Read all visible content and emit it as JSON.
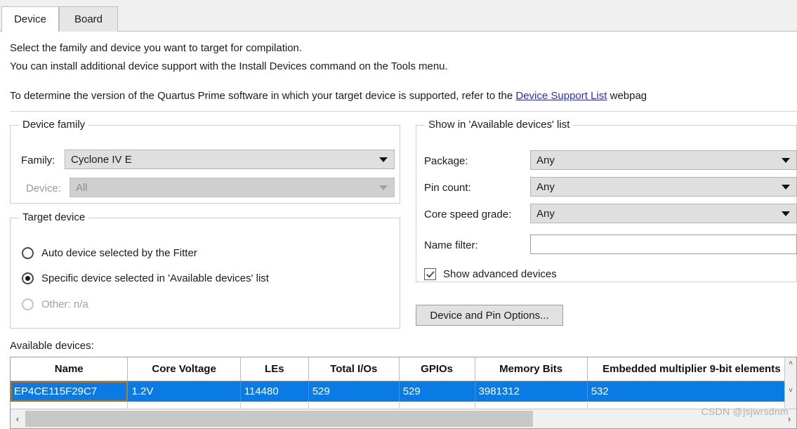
{
  "tabs": [
    {
      "label": "Device",
      "active": true
    },
    {
      "label": "Board",
      "active": false
    }
  ],
  "description": {
    "line1": "Select the family and device you want to target for compilation.",
    "line2": "You can install additional device support with the Install Devices command on the Tools menu.",
    "line3_before": "To determine the version of the Quartus Prime software in which your target device is supported, refer to the ",
    "line3_link": "Device Support List",
    "line3_after": " webpag"
  },
  "device_family": {
    "legend": "Device family",
    "family_label": "Family:",
    "family_value": "Cyclone IV E",
    "device_label": "Device:",
    "device_value": "All",
    "device_disabled": true
  },
  "target_device": {
    "legend": "Target device",
    "options": [
      {
        "label": "Auto device selected by the Fitter",
        "checked": false,
        "disabled": false
      },
      {
        "label": "Specific device selected in 'Available devices' list",
        "checked": true,
        "disabled": false
      },
      {
        "label": "Other:  n/a",
        "checked": false,
        "disabled": true
      }
    ]
  },
  "show_list": {
    "legend": "Show in 'Available devices' list",
    "package_label": "Package:",
    "package_value": "Any",
    "pin_count_label": "Pin count:",
    "pin_count_value": "Any",
    "core_speed_label": "Core speed grade:",
    "core_speed_value": "Any",
    "name_filter_label": "Name filter:",
    "name_filter_value": "",
    "name_filter_placeholder": "",
    "show_advanced_label": "Show advanced devices",
    "show_advanced_checked": true
  },
  "device_pin_options_button": "Device and Pin Options...",
  "available_devices": {
    "label": "Available devices:",
    "columns": [
      "Name",
      "Core Voltage",
      "LEs",
      "Total I/Os",
      "GPIOs",
      "Memory Bits",
      "Embedded multiplier 9-bit elements"
    ],
    "rows": [
      {
        "selected": true,
        "cells": [
          "EP4CE115F29C7",
          "1.2V",
          "114480",
          "529",
          "529",
          "3981312",
          "532"
        ]
      }
    ]
  },
  "scrollbars": {
    "left_arrow": "‹",
    "right_arrow": "›",
    "up_arrow": "˄",
    "down_arrow": "˅"
  },
  "watermark": "CSDN @jsjwrsdnm",
  "colors": {
    "selection_blue": "#0a7ae4",
    "link_blue": "#2b2bd4",
    "group_border": "#cdcdcd"
  }
}
